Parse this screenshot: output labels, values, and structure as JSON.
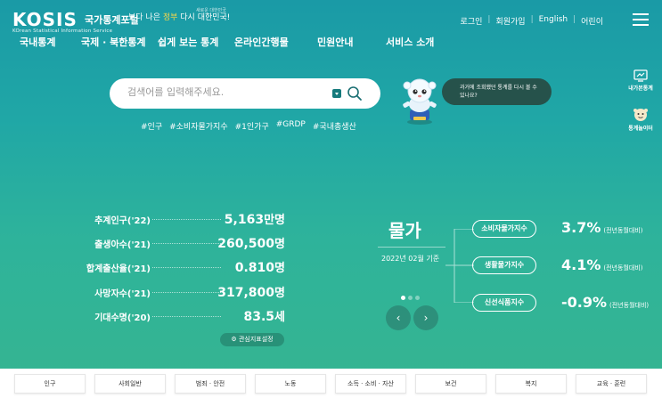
{
  "header": {
    "logo_main": "KOSIS",
    "logo_kr": "국가통계포털",
    "logo_sub": "KOrean Statistical Information Service",
    "slogan_a": "보다 나은 ",
    "slogan_b": "정부",
    "slogan_c": " 다시 대한민국!",
    "slogan_small": "새로운 대한민국",
    "utility": [
      "로그인",
      "회원가입",
      "English",
      "어린이"
    ]
  },
  "gnb": [
    "국내통계",
    "국제 · 북한통계",
    "쉽게 보는 통계",
    "온라인간행물",
    "민원안내",
    "서비스 소개"
  ],
  "search": {
    "placeholder": "검색어를 입력해주세요.",
    "tags": [
      "#인구",
      "#소비자물가지수",
      "#1인가구",
      "#GRDP",
      "#국내총생산"
    ]
  },
  "mascot_bubble": "과거에 조회했던 통계를 다시 볼 수 있나요?",
  "side": {
    "my_stats": "내가본통계",
    "playground": "통계놀이터"
  },
  "stats": [
    {
      "label": "추계인구('22)",
      "value": "5,163",
      "unit": "만명"
    },
    {
      "label": "출생아수('21)",
      "value": "260,500",
      "unit": "명"
    },
    {
      "label": "합계출산율('21)",
      "value": "0.810",
      "unit": "명"
    },
    {
      "label": "사망자수('21)",
      "value": "317,800",
      "unit": "명"
    },
    {
      "label": "기대수명('20)",
      "value": "83.5",
      "unit": "세"
    }
  ],
  "stats_setting": "관심지표설정",
  "price": {
    "title": "물가",
    "date": "2022년 02월 기준",
    "items": [
      {
        "label": "소비자물가지수",
        "value": "3.7%",
        "note": "(전년동월대비)"
      },
      {
        "label": "생활물가지수",
        "value": "4.1%",
        "note": "(전년동월대비)"
      },
      {
        "label": "신선식품지수",
        "value": "-0.9%",
        "note": "(전년동월대비)"
      }
    ]
  },
  "categories": [
    "인구",
    "사회일반",
    "범죄 · 안전",
    "노동",
    "소득 · 소비 · 자산",
    "보건",
    "복지",
    "교육 · 훈련"
  ],
  "colors": {
    "accent_dark": "#26524b",
    "highlight": "#f6d64b"
  }
}
